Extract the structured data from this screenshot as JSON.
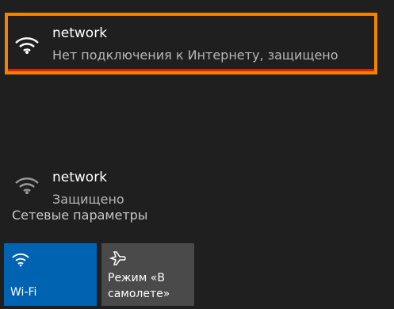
{
  "networks": [
    {
      "name": "network",
      "status": "Нет подключения к Интернету, защищено",
      "selected": true
    },
    {
      "name": "network",
      "status": "Защищено",
      "selected": false
    }
  ],
  "settings_link": "Сетевые параметры",
  "tiles": {
    "wifi": {
      "label": "Wi-Fi",
      "icon": "wifi-icon",
      "active": true
    },
    "airplane": {
      "label": "Режим «В самолете»",
      "icon": "airplane-icon",
      "active": false
    }
  },
  "colors": {
    "background": "#1f1f1f",
    "highlight_border": "#f08400",
    "wifi_tile": "#0063b1",
    "airplane_tile": "#4a4a4a"
  }
}
